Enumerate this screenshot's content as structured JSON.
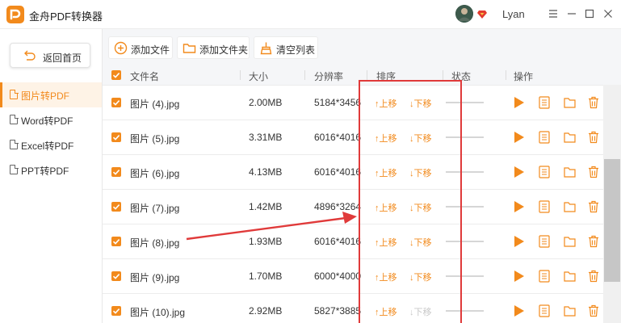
{
  "app": {
    "title": "金舟PDF转换器"
  },
  "user": {
    "name": "Lyan"
  },
  "sidebar": {
    "back_label": "返回首页",
    "items": [
      {
        "label": "图片转PDF",
        "active": true
      },
      {
        "label": "Word转PDF",
        "active": false
      },
      {
        "label": "Excel转PDF",
        "active": false
      },
      {
        "label": "PPT转PDF",
        "active": false
      }
    ]
  },
  "toolbar": {
    "add_file": "添加文件",
    "add_folder": "添加文件夹",
    "clear_list": "清空列表"
  },
  "table": {
    "headers": {
      "name": "文件名",
      "size": "大小",
      "resolution": "分辨率",
      "order": "排序",
      "status": "状态",
      "actions": "操作"
    },
    "move_up": "上移",
    "move_down": "下移",
    "rows": [
      {
        "name": "图片 (4).jpg",
        "size": "2.00MB",
        "resolution": "5184*3456",
        "down_enabled": true
      },
      {
        "name": "图片 (5).jpg",
        "size": "3.31MB",
        "resolution": "6016*4016",
        "down_enabled": true
      },
      {
        "name": "图片 (6).jpg",
        "size": "4.13MB",
        "resolution": "6016*4016",
        "down_enabled": true
      },
      {
        "name": "图片 (7).jpg",
        "size": "1.42MB",
        "resolution": "4896*3264",
        "down_enabled": true
      },
      {
        "name": "图片 (8).jpg",
        "size": "1.93MB",
        "resolution": "6016*4016",
        "down_enabled": true
      },
      {
        "name": "图片 (9).jpg",
        "size": "1.70MB",
        "resolution": "6000*4000",
        "down_enabled": true
      },
      {
        "name": "图片 (10).jpg",
        "size": "2.92MB",
        "resolution": "5827*3885",
        "down_enabled": false
      }
    ]
  },
  "colors": {
    "accent": "#f28a1c",
    "annotation": "#e03a3a"
  }
}
